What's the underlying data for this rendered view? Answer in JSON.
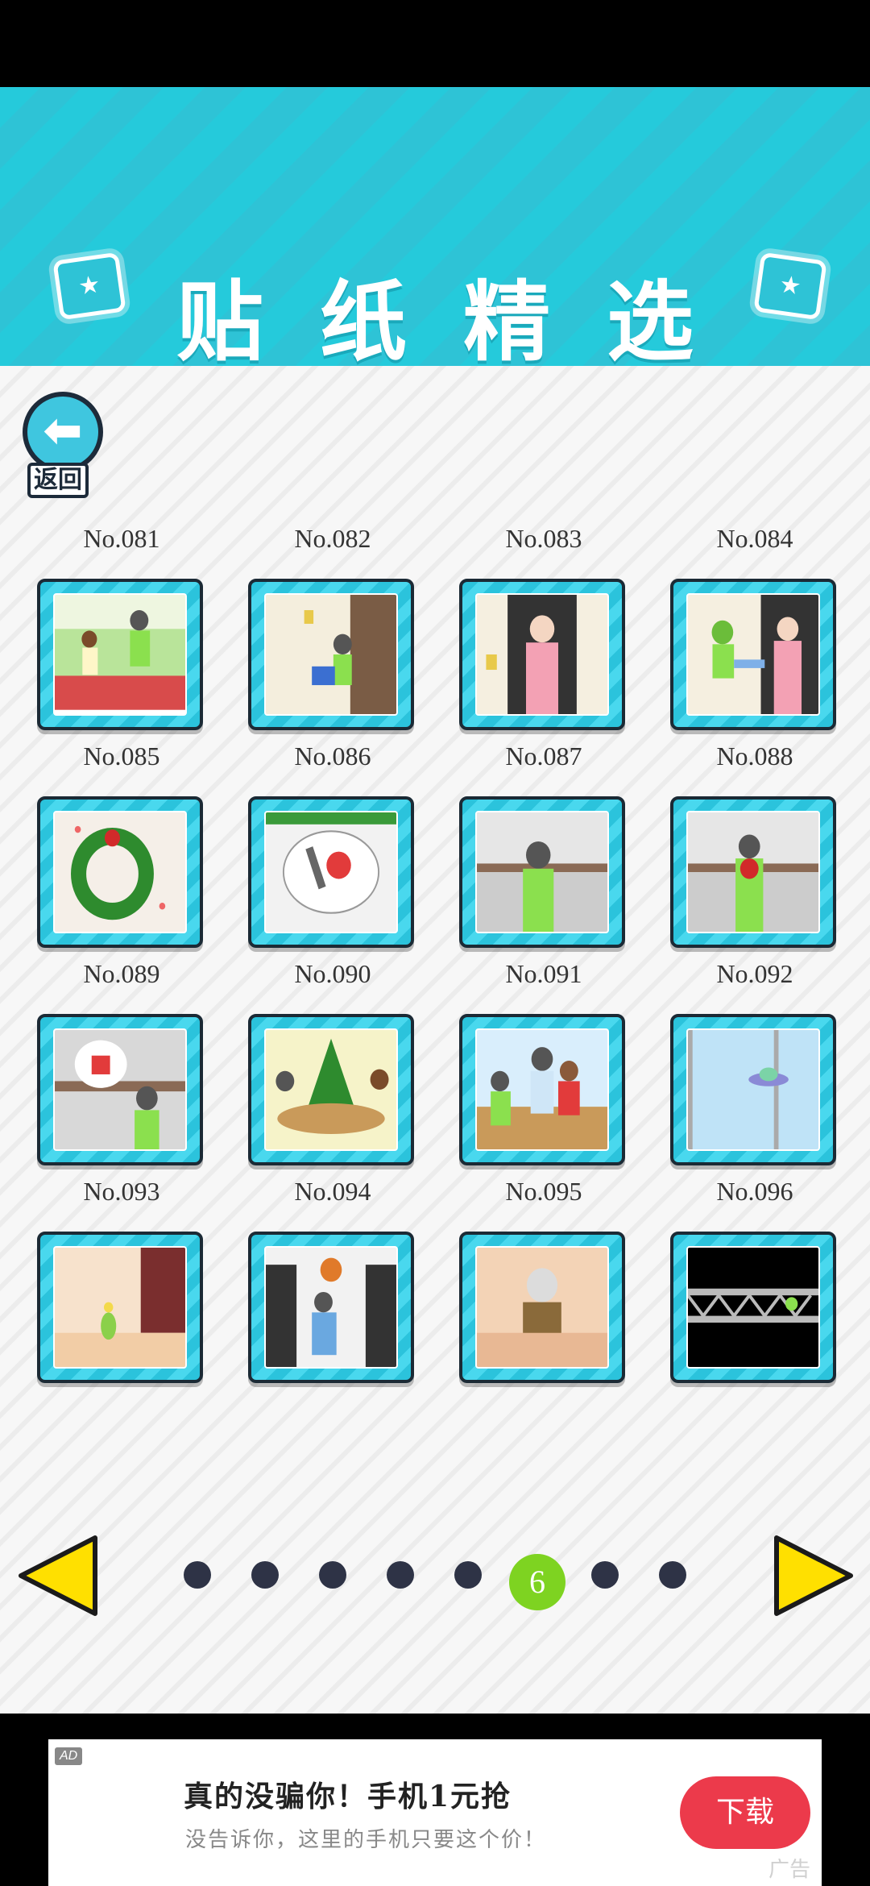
{
  "header": {
    "title": "贴纸精选",
    "left_icon": "star-badge-icon",
    "right_icon": "star-badge-icon"
  },
  "back_button": {
    "icon": "left-arrow-icon",
    "label": "返回"
  },
  "stickers": [
    {
      "label": "No.081",
      "scene": "kids-by-car"
    },
    {
      "label": "No.082",
      "scene": "boy-at-door"
    },
    {
      "label": "No.083",
      "scene": "woman-in-doorway"
    },
    {
      "label": "No.084",
      "scene": "delivery-at-door"
    },
    {
      "label": "No.085",
      "scene": "christmas-wreath"
    },
    {
      "label": "No.086",
      "scene": "santa-thought"
    },
    {
      "label": "No.087",
      "scene": "boy-worried"
    },
    {
      "label": "No.088",
      "scene": "boy-with-flowers"
    },
    {
      "label": "No.089",
      "scene": "gift-thought"
    },
    {
      "label": "No.090",
      "scene": "christmas-party"
    },
    {
      "label": "No.091",
      "scene": "classroom-friends"
    },
    {
      "label": "No.092",
      "scene": "ufo-window"
    },
    {
      "label": "No.093",
      "scene": "vase-room"
    },
    {
      "label": "No.094",
      "scene": "basketball-crowd"
    },
    {
      "label": "No.095",
      "scene": "old-man-desk"
    },
    {
      "label": "No.096",
      "scene": "dark-bridge"
    }
  ],
  "pagination": {
    "current_page": "6",
    "current_index": 5,
    "total_pages": 8,
    "prev_icon": "left-triangle-icon",
    "next_icon": "right-triangle-icon"
  },
  "ad": {
    "tag": "AD",
    "title": "真的没骗你！手机1元抢",
    "subtitle": "没告诉你，这里的手机只要这个价！",
    "button": "下载",
    "corner": "广告"
  },
  "colors": {
    "header_cyan": "#2ec3d6",
    "card_cyan": "#2bc3dc",
    "active_dot": "#7ed321",
    "dot": "#2e3346",
    "arrow_yellow": "#ffe000",
    "ad_button": "#ec3a4b"
  }
}
